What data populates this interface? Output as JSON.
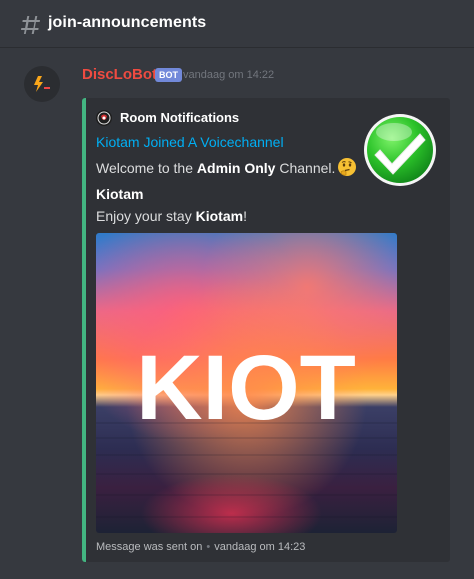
{
  "channel": {
    "name": "join-announcements"
  },
  "message": {
    "author": "DiscLoBot",
    "bot_tag": "BOT",
    "timestamp": "vandaag om 14:22"
  },
  "embed": {
    "author_name": "Room Notifications",
    "title": "Kiotam Joined A Voicechannel",
    "desc_prefix": "Welcome to the ",
    "desc_bold": "Admin Only",
    "desc_suffix": " Channel.",
    "field_name": "Kiotam",
    "field_value_prefix": "Enjoy your stay ",
    "field_value_bold": "Kiotam",
    "field_value_suffix": "!",
    "image_text": "KIOT",
    "footer_text": "Message was sent on",
    "footer_separator": "•",
    "footer_time": "vandaag om 14:23",
    "accent_color": "#43b581"
  },
  "icons": {
    "hash": "hash-channel-icon",
    "avatar": "bot-avatar-lightning-icon",
    "thumbnail": "green-checkmark-icon",
    "emoji": "thinking-face-emoji"
  },
  "colors": {
    "author": "#ef4b41",
    "link": "#00aff4",
    "background": "#36393f",
    "embed_bg": "#2f3136"
  }
}
